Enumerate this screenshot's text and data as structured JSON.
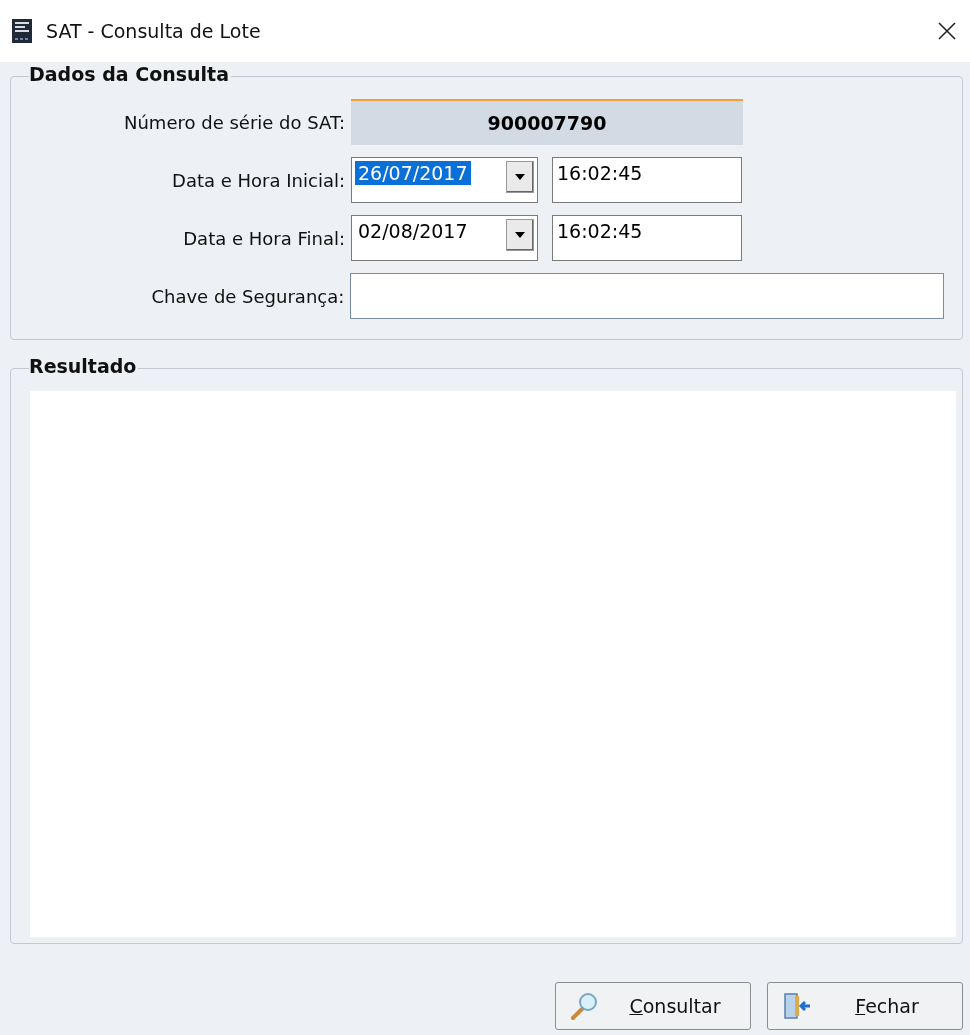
{
  "window": {
    "title": "SAT - Consulta de Lote"
  },
  "query_group": {
    "title": "Dados da Consulta",
    "serial": {
      "label": "Número de série do SAT:",
      "value": "900007790"
    },
    "start": {
      "label": "Data e Hora Inicial:",
      "date": "26/07/2017",
      "date_selected": true,
      "time": "16:02:45"
    },
    "end": {
      "label": "Data e Hora Final:",
      "date": "02/08/2017",
      "date_selected": false,
      "time": "16:02:45"
    },
    "security_key": {
      "label": "Chave de Segurança:"
    }
  },
  "result_group": {
    "title": "Resultado"
  },
  "buttons": [
    {
      "kind": "search",
      "label": "Consultar"
    },
    {
      "kind": "exit",
      "label": "Fechar"
    }
  ]
}
